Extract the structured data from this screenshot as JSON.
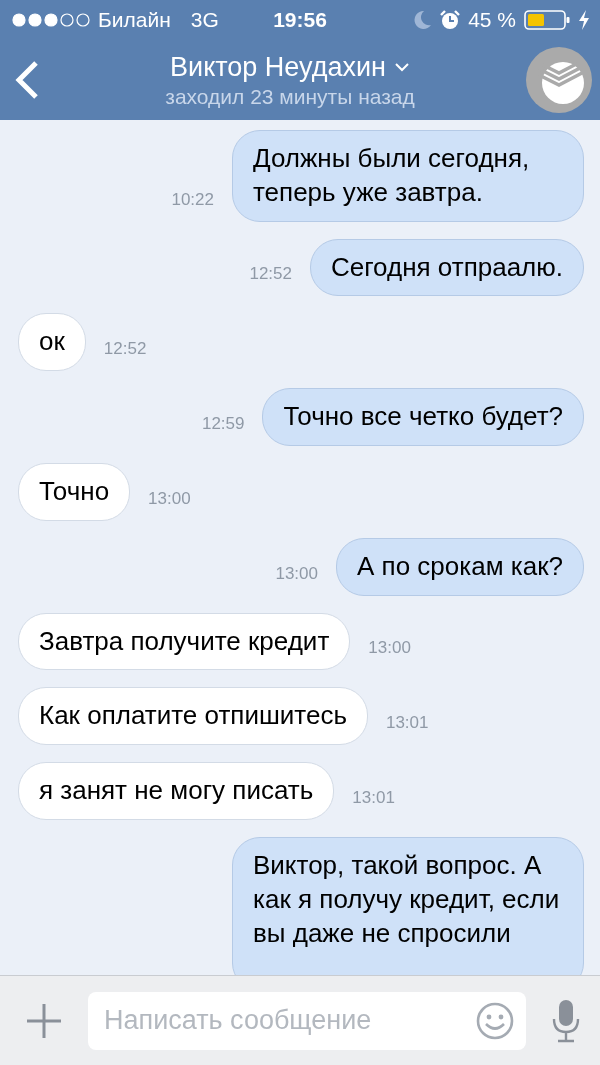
{
  "status_bar": {
    "carrier": "Билайн",
    "network": "3G",
    "time": "19:56",
    "battery": "45 %"
  },
  "header": {
    "title": "Виктор Неудахин",
    "subtitle": "заходил 23 минуты назад"
  },
  "messages": [
    {
      "kind": "outgoing",
      "text": "Должны были сегодня, теперь уже завтра.",
      "time": "10:22"
    },
    {
      "kind": "outgoing",
      "text": "Сегодня отпраалю.",
      "time": "12:52"
    },
    {
      "kind": "incoming",
      "text": "ок",
      "time": "12:52"
    },
    {
      "kind": "outgoing",
      "text": "Точно все четко будет?",
      "time": "12:59"
    },
    {
      "kind": "incoming",
      "text": "Точно",
      "time": "13:00"
    },
    {
      "kind": "outgoing",
      "text": "А по срокам как?",
      "time": "13:00"
    },
    {
      "kind": "incoming",
      "text": "Завтра получите кредит",
      "time": "13:00"
    },
    {
      "kind": "incoming",
      "text": "Как оплатите отпишитесь",
      "time": "13:01"
    },
    {
      "kind": "incoming",
      "text": "я занят не могу писать",
      "time": "13:01"
    },
    {
      "kind": "outgoing",
      "text": "Виктор, такой вопрос. А как я получу кредит, если вы даже не спросили"
    }
  ],
  "composer": {
    "placeholder": "Написать сообщение"
  }
}
